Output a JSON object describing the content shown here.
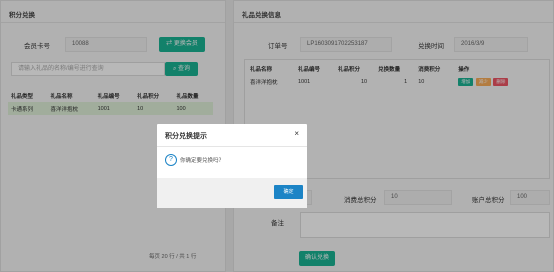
{
  "left": {
    "title": "积分兑换",
    "card_label": "会员卡号",
    "card_value": "10088",
    "change_member_label": "更换会员",
    "search_placeholder": "请输入礼品的名称/编号进行查询",
    "search_label": "查询",
    "columns": [
      "礼品类型",
      "礼品名称",
      "礼品编号",
      "礼品积分",
      "礼品数量"
    ],
    "rows": [
      [
        "卡通系列",
        "喜洋洋抱枕",
        "1001",
        "10",
        "100"
      ]
    ],
    "pagination": "每页 20 行 / 共 1 行"
  },
  "right": {
    "title": "礼品兑换信息",
    "order_label": "订单号",
    "order_value": "LP1603091702253187",
    "time_label": "兑换时间",
    "time_value": "2016/3/9",
    "columns": [
      "礼品名称",
      "礼品编号",
      "礼品积分",
      "兑换数量",
      "消费积分",
      "操作"
    ],
    "rows": [
      {
        "name": "喜洋洋抱枕",
        "code": "1001",
        "points": "10",
        "qty": "1",
        "cost": "10"
      }
    ],
    "actions": {
      "add": "增加",
      "reduce": "减少",
      "delete": "删除"
    },
    "total_cost_label": "消费总积分",
    "total_cost_value": "10",
    "account_total_label": "账户总积分",
    "account_total_value": "100",
    "remark_label": "备注",
    "confirm_label": "确认兑换"
  },
  "modal": {
    "title": "积分兑换提示",
    "close": "×",
    "question_icon": "?",
    "message": "你确定要兑换吗？",
    "ok_label": "确定"
  },
  "colors": {
    "green": "#1ab394",
    "blue": "#1c84c6",
    "orange": "#f8ac59",
    "red": "#ed5565"
  }
}
